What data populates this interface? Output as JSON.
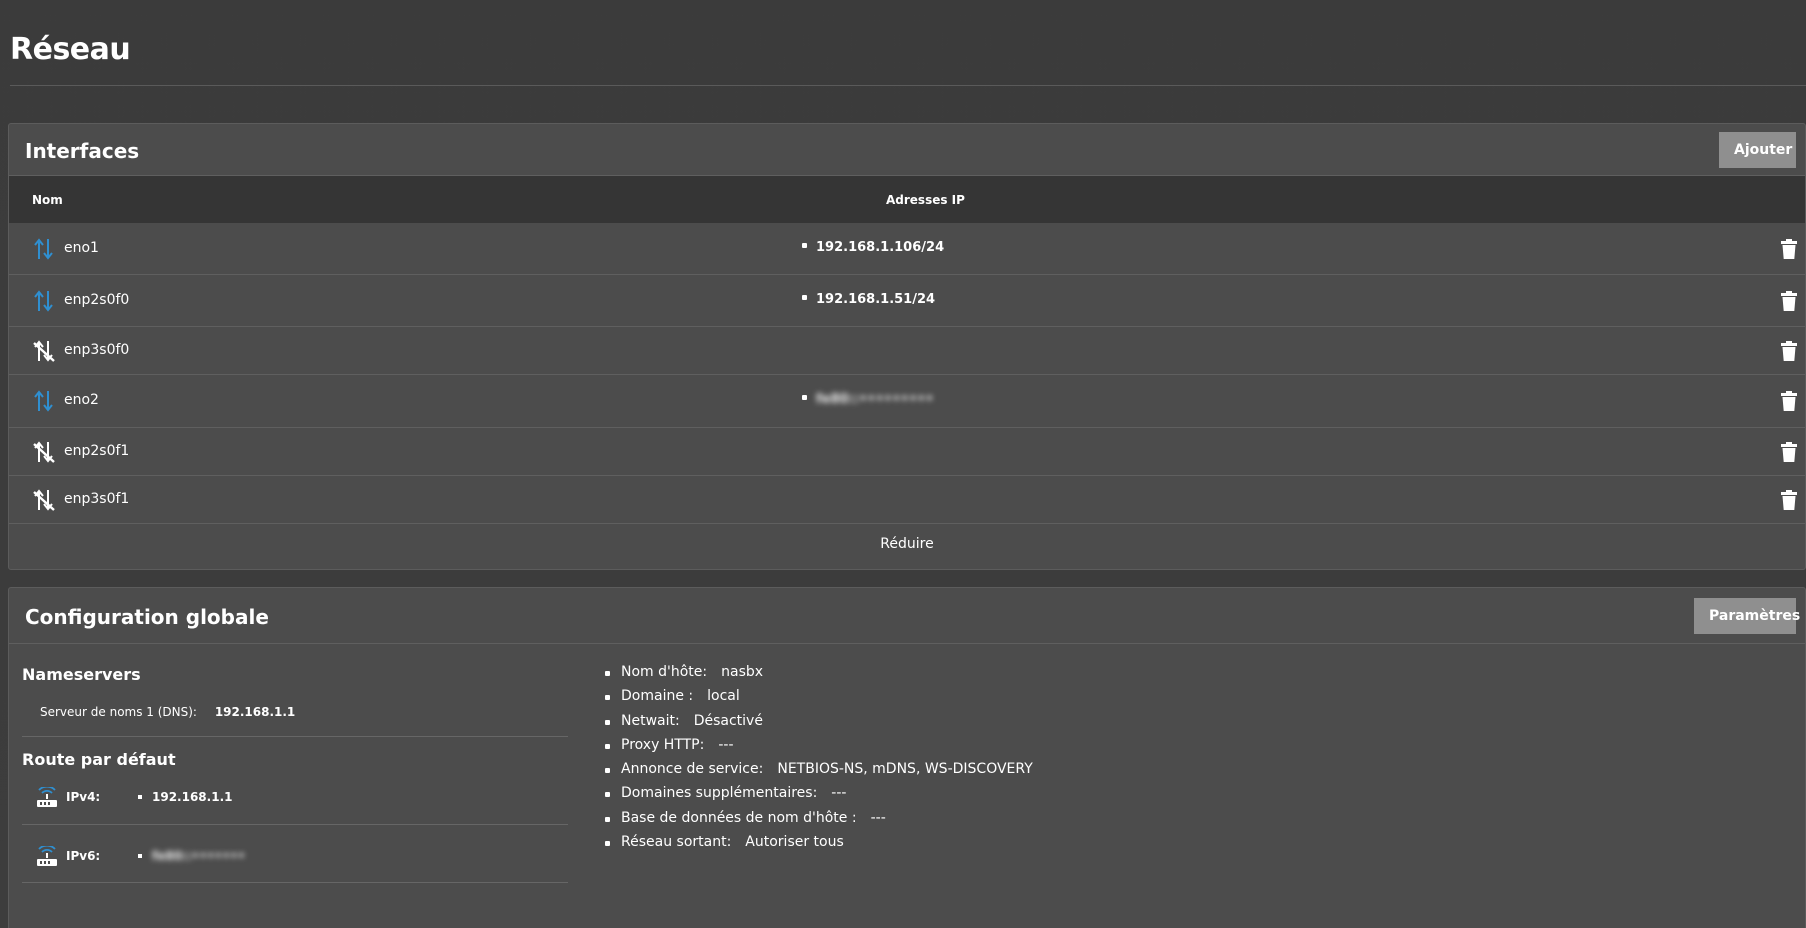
{
  "page": {
    "title": "Réseau"
  },
  "interfaces": {
    "title": "Interfaces",
    "add_label": "Ajouter",
    "col_name": "Nom",
    "col_ip": "Adresses IP",
    "rows": [
      {
        "name": "eno1",
        "ip": "192.168.1.106/24",
        "status_icon": "link-up-arrows-icon",
        "ip_blurred": false
      },
      {
        "name": "enp2s0f0",
        "ip": "192.168.1.51/24",
        "status_icon": "link-up-arrows-icon",
        "ip_blurred": false
      },
      {
        "name": "enp3s0f0",
        "ip": "",
        "status_icon": "link-down-icon",
        "ip_blurred": false
      },
      {
        "name": "eno2",
        "ip": "fe80::•••••••••",
        "status_icon": "link-up-arrows-icon",
        "ip_blurred": true
      },
      {
        "name": "enp2s0f1",
        "ip": "",
        "status_icon": "link-down-icon",
        "ip_blurred": false
      },
      {
        "name": "enp3s0f1",
        "ip": "",
        "status_icon": "link-down-icon",
        "ip_blurred": false
      }
    ],
    "reduce_label": "Réduire"
  },
  "global": {
    "title": "Configuration globale",
    "settings_label": "Paramètres",
    "nameservers": {
      "title": "Nameservers",
      "dns1_label": "Serveur de noms 1 (DNS):",
      "dns1_value": "192.168.1.1"
    },
    "default_route": {
      "title": "Route par défaut",
      "ipv4_label": "IPv4:",
      "ipv4_value": "192.168.1.1",
      "ipv6_label": "IPv6:",
      "ipv6_value": "fe80::•••••••"
    },
    "info": [
      {
        "label": "Nom d'hôte:",
        "value": "nasbx"
      },
      {
        "label": "Domaine :",
        "value": "local"
      },
      {
        "label": "Netwait:",
        "value": "Désactivé"
      },
      {
        "label": "Proxy HTTP:",
        "value": "---"
      },
      {
        "label": "Annonce de service:",
        "value": "NETBIOS-NS, mDNS, WS-DISCOVERY"
      },
      {
        "label": "Domaines supplémentaires:",
        "value": "---"
      },
      {
        "label": "Base de données de nom d'hôte :",
        "value": "---"
      },
      {
        "label": "Réseau sortant:",
        "value": "Autoriser tous"
      }
    ]
  },
  "colors": {
    "accent_blue": "#2f8fd0",
    "background": "#3c3c3c",
    "card": "#4c4c4c",
    "table_header": "#353535",
    "button": "#8f8f8f"
  }
}
